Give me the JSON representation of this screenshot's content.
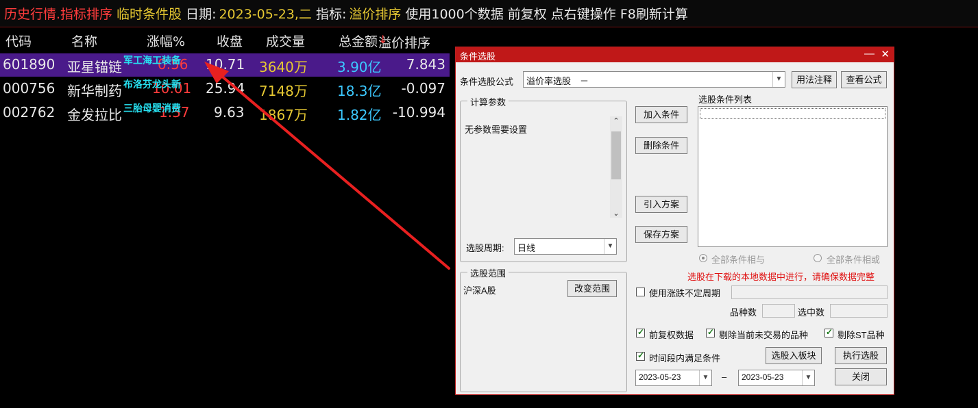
{
  "header": {
    "mode": "历史行情.指标排序",
    "condition": "临时条件股",
    "date_label": "日期:",
    "date_value": "2023-05-23,二",
    "indicator_label": "指标:",
    "indicator_value": "溢价排序",
    "info": "使用1000个数据 前复权 点右键操作 F8刷新计算"
  },
  "table": {
    "columns": [
      "代码",
      "名称",
      "涨幅%",
      "收盘",
      "成交量",
      "总金额",
      "溢价排序"
    ],
    "sort_arrow": "↓",
    "rows": [
      {
        "code": "601890",
        "name": "亚星锚链",
        "change": "0.56",
        "close": "10.71",
        "volume": "3640万",
        "amount": "3.90亿",
        "premium": "7.843",
        "tag": "军工海工装备"
      },
      {
        "code": "000756",
        "name": "新华制药",
        "change": "10.01",
        "close": "25.94",
        "volume": "7148万",
        "amount": "18.3亿",
        "premium": "-0.097",
        "tag": "布洛芬龙头新"
      },
      {
        "code": "002762",
        "name": "金发拉比",
        "change": "1.37",
        "close": "9.63",
        "volume": "1867万",
        "amount": "1.82亿",
        "premium": "-10.994",
        "tag": "三胎母婴消费"
      }
    ]
  },
  "colors": {
    "selected_row": "#4a1a8a",
    "dialog_title": "#c01818",
    "up": "#ff3c3c",
    "amount": "#3cc8ff",
    "volume": "#e6c832",
    "arrow": "#e82020"
  },
  "dialog": {
    "title": "条件选股",
    "window_icons": [
      "minimize-icon",
      "close-icon"
    ],
    "minimize_glyph": "—",
    "close_glyph": "✕",
    "formula_label": "条件选股公式",
    "formula_value": "溢价率选股　－",
    "usage_button": "用法注释",
    "view_formula_button": "查看公式",
    "params_group_title": "计算参数",
    "params_text": "无参数需要设置",
    "cond_list_title": "选股条件列表",
    "add_cond_button": "加入条件",
    "del_cond_button": "删除条件",
    "import_button": "引入方案",
    "save_button": "保存方案",
    "period_label": "选股周期:",
    "period_value": "日线",
    "radio_and": "全部条件相与",
    "radio_or": "全部条件相或",
    "scope_group_title": "选股范围",
    "scope_value": "沪深A股",
    "change_scope_button": "改变范围",
    "warning": "选股在下载的本地数据中进行，请确保数据完整",
    "uncertain_period_label": "使用涨跌不定周期",
    "count_label": "品种数",
    "selected_label": "选中数",
    "chk_fq_label": "前复权数据",
    "chk_exclude_label": "剔除当前未交易的品种",
    "chk_st_label": "剔除ST品种",
    "chk_period_label": "时间段内满足条件",
    "to_block_button": "选股入板块",
    "execute_button": "执行选股",
    "close_button": "关闭",
    "date_from": "2023-05-23",
    "date_to": "2023-05-23",
    "date_sep": "–"
  }
}
